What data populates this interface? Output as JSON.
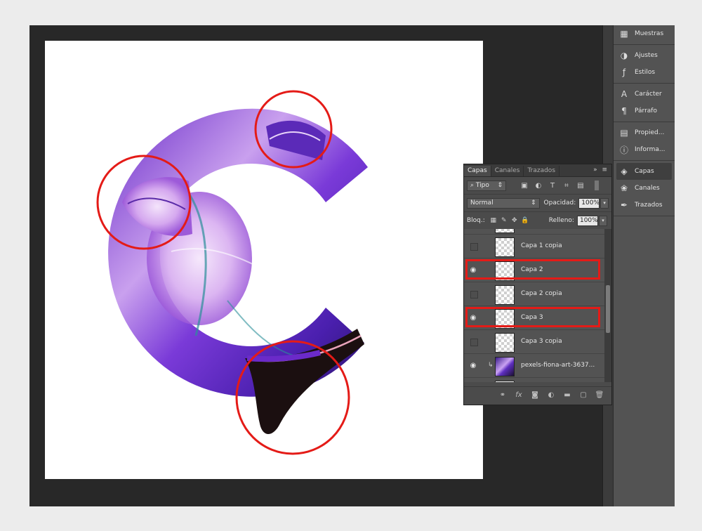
{
  "dock": {
    "groups": [
      [
        {
          "label": "Muestras",
          "icon": "grid-swatches-icon"
        }
      ],
      [
        {
          "label": "Ajustes",
          "icon": "adjustments-circle-icon"
        },
        {
          "label": "Estilos",
          "icon": "fx-styles-icon"
        }
      ],
      [
        {
          "label": "Carácter",
          "icon": "character-type-icon"
        },
        {
          "label": "Párrafo",
          "icon": "paragraph-pilcrow-icon"
        }
      ],
      [
        {
          "label": "Propied...",
          "icon": "properties-icon"
        },
        {
          "label": "Informa...",
          "icon": "info-icon"
        }
      ],
      [
        {
          "label": "Capas",
          "icon": "layers-stack-icon",
          "active": true
        },
        {
          "label": "Canales",
          "icon": "channels-icon"
        },
        {
          "label": "Trazados",
          "icon": "paths-pen-icon"
        }
      ]
    ]
  },
  "layers_panel": {
    "tabs": [
      {
        "label": "Capas",
        "active": true
      },
      {
        "label": "Canales"
      },
      {
        "label": "Trazados"
      }
    ],
    "filter_kind": "Tipo",
    "blend_mode": "Normal",
    "opacity_label": "Opacidad:",
    "opacity_value": "100%",
    "lock_label": "Bloq.:",
    "fill_label": "Relleno:",
    "fill_value": "100%",
    "layers": [
      {
        "name": "Capa 1 copia",
        "visible": false,
        "highlighted": false,
        "thumb": "transparent"
      },
      {
        "name": "Capa 2",
        "visible": true,
        "highlighted": true,
        "thumb": "transparent"
      },
      {
        "name": "Capa 2 copia",
        "visible": false,
        "highlighted": false,
        "thumb": "transparent"
      },
      {
        "name": "Capa 3",
        "visible": true,
        "highlighted": true,
        "thumb": "transparent"
      },
      {
        "name": "Capa 3 copia",
        "visible": false,
        "highlighted": false,
        "thumb": "transparent"
      },
      {
        "name": "pexels-fiona-art-3637...",
        "visible": true,
        "highlighted": false,
        "thumb": "art",
        "clipped": true
      }
    ]
  },
  "colors": {
    "highlight_red": "#e41b17",
    "canvas": "#ffffff",
    "workspace": "#282828",
    "panel": "#4b4b4b"
  }
}
